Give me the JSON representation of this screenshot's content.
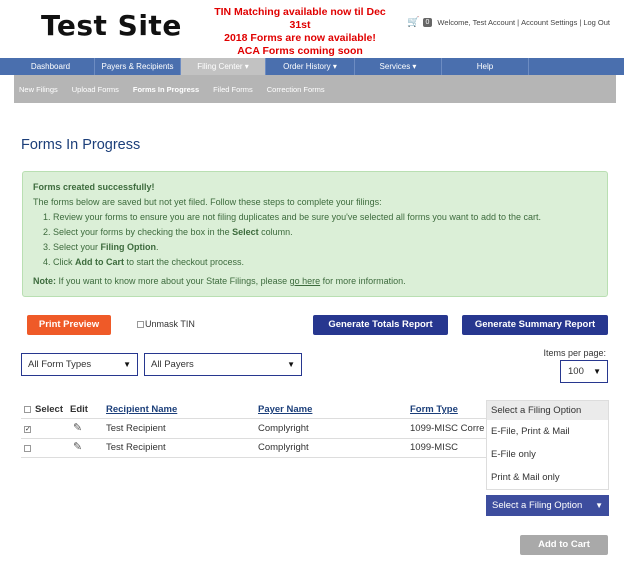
{
  "header": {
    "site_title": "Test Site",
    "announcement": [
      "TIN Matching available now til Dec 31st",
      "2018 Forms are now available!",
      "ACA Forms coming soon"
    ],
    "cart_count": "0",
    "welcome": "Welcome, Test Account",
    "account_settings": "Account Settings",
    "logout": "Log Out",
    "separator": "|"
  },
  "mainnav": [
    {
      "label": "Dashboard",
      "active": false
    },
    {
      "label": "Payers & Recipients",
      "active": false
    },
    {
      "label": "Filing Center ▾",
      "active": true
    },
    {
      "label": "Order History ▾",
      "active": false
    },
    {
      "label": "Services ▾",
      "active": false
    },
    {
      "label": "Help",
      "active": false
    }
  ],
  "subnav": [
    {
      "label": "New Filings",
      "active": false
    },
    {
      "label": "Upload Forms",
      "active": false
    },
    {
      "label": "Forms In Progress",
      "active": true
    },
    {
      "label": "Filed Forms",
      "active": false
    },
    {
      "label": "Correction Forms",
      "active": false
    }
  ],
  "page_title": "Forms In Progress",
  "alert": {
    "heading": "Forms created successfully!",
    "intro": "The forms below are saved but not yet filed. Follow these steps to complete your filings:",
    "steps": [
      {
        "pre": "Review your forms to ensure you are not filing duplicates and be sure you've selected all forms you want to add to the cart.",
        "bold": "",
        "post": ""
      },
      {
        "pre": "Select your forms by checking the box in the ",
        "bold": "Select",
        "post": " column."
      },
      {
        "pre": "Select your ",
        "bold": "Filing Option",
        "post": "."
      },
      {
        "pre": "Click ",
        "bold": "Add to Cart",
        "post": " to start the checkout process."
      }
    ],
    "note_label": "Note:",
    "note_pre": " If you want to know more about your State Filings, please ",
    "note_link": "go here",
    "note_post": " for more information."
  },
  "actions": {
    "print_preview": "Print Preview",
    "unmask_tin": "Unmask TIN",
    "generate_totals": "Generate Totals Report",
    "generate_summary": "Generate Summary Report"
  },
  "filters": {
    "form_types": "All Form Types",
    "payers": "All Payers",
    "items_per_page_label": "Items per page:",
    "items_per_page": "100"
  },
  "table": {
    "headers": {
      "select": "Select",
      "edit": "Edit",
      "recipient": "Recipient Name",
      "payer": "Payer Name",
      "form_type": "Form Type"
    },
    "rows": [
      {
        "checked": true,
        "recipient": "Test Recipient",
        "payer": "Complyright",
        "form_type": "1099-MISC Corre"
      },
      {
        "checked": false,
        "recipient": "Test Recipient",
        "payer": "Complyright",
        "form_type": "1099-MISC"
      }
    ]
  },
  "filing_dropdown": {
    "options": [
      "Select a Filing Option",
      "E-File, Print & Mail",
      "E-File only",
      "Print & Mail only"
    ],
    "selected": "Select a Filing Option"
  },
  "add_to_cart": "Add to Cart"
}
